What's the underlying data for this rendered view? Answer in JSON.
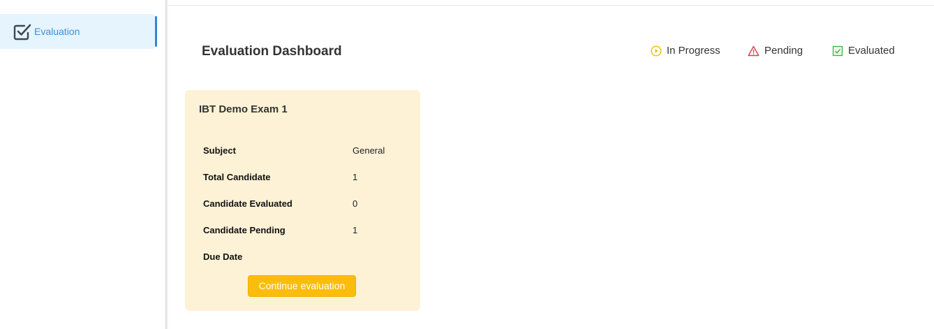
{
  "sidebar": {
    "items": [
      {
        "label": "Evaluation",
        "icon": "checkbox-check-icon",
        "active": true
      }
    ],
    "accent_color": "#2f86d6",
    "active_bg": "#e6f4fd"
  },
  "header": {
    "title": "Evaluation Dashboard",
    "legend": [
      {
        "label": "In Progress",
        "icon": "play-circle-icon",
        "color": "#f5b800"
      },
      {
        "label": "Pending",
        "icon": "warning-triangle-icon",
        "color": "#e0394b"
      },
      {
        "label": "Evaluated",
        "icon": "checkbox-check-icon",
        "color": "#3cb34a"
      }
    ]
  },
  "cards": [
    {
      "title": "IBT Demo Exam 1",
      "status_color": "#fef2d6",
      "fields": [
        {
          "label": "Subject",
          "value": "General"
        },
        {
          "label": "Total Candidate",
          "value": "1"
        },
        {
          "label": "Candidate Evaluated",
          "value": "0"
        },
        {
          "label": "Candidate Pending",
          "value": "1"
        },
        {
          "label": "Due Date",
          "value": ""
        }
      ],
      "button_label": "Continue evaluation",
      "button_color": "#fbbd0c"
    }
  ]
}
